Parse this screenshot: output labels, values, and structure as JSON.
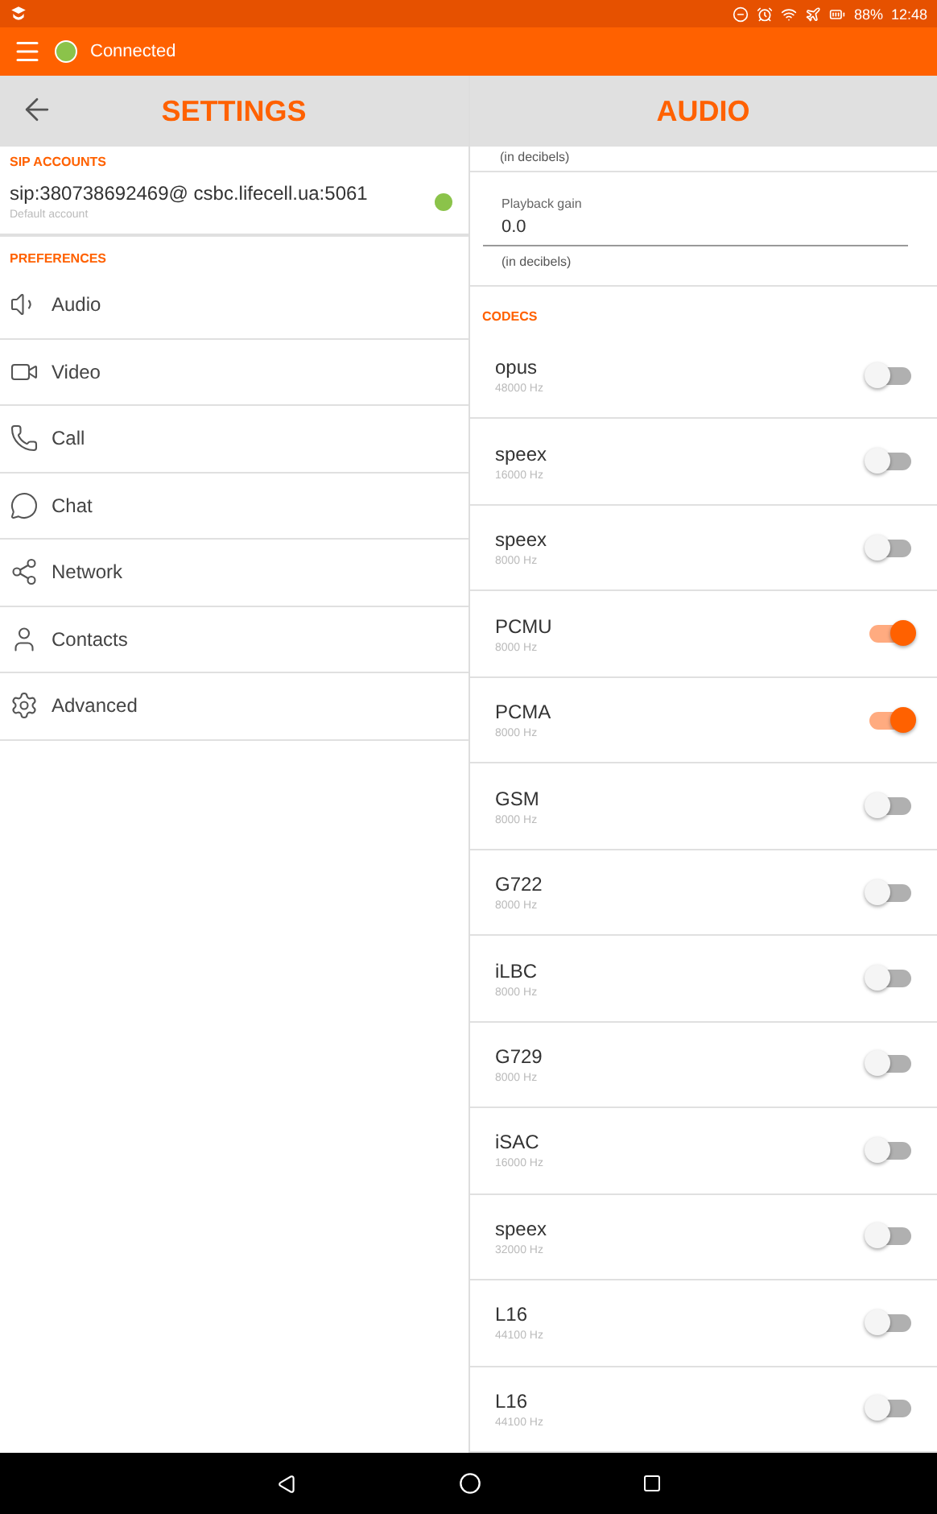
{
  "status_bar": {
    "battery": "88%",
    "time": "12:48"
  },
  "toolbar": {
    "status": "Connected",
    "connected": true
  },
  "left": {
    "title": "SETTINGS",
    "sip_header": "SIP ACCOUNTS",
    "account": {
      "address": "sip:380738692469@ csbc.lifecell.ua:5061",
      "subtitle": "Default account",
      "online": true
    },
    "pref_header": "PREFERENCES",
    "items": [
      {
        "label": "Audio",
        "kind": "audio"
      },
      {
        "label": "Video",
        "kind": "video"
      },
      {
        "label": "Call",
        "kind": "call"
      },
      {
        "label": "Chat",
        "kind": "chat"
      },
      {
        "label": "Network",
        "kind": "network"
      },
      {
        "label": "Contacts",
        "kind": "contacts"
      },
      {
        "label": "Advanced",
        "kind": "advanced"
      }
    ]
  },
  "right": {
    "title": "AUDIO",
    "prev_hint": "(in decibels)",
    "playback": {
      "label": "Playback gain",
      "value": "0.0",
      "hint": "(in decibels)"
    },
    "codecs_header": "CODECS",
    "codecs": [
      {
        "name": "opus",
        "rate": "48000 Hz",
        "on": false
      },
      {
        "name": "speex",
        "rate": "16000 Hz",
        "on": false
      },
      {
        "name": "speex",
        "rate": "8000 Hz",
        "on": false
      },
      {
        "name": "PCMU",
        "rate": "8000 Hz",
        "on": true
      },
      {
        "name": "PCMA",
        "rate": "8000 Hz",
        "on": true
      },
      {
        "name": "GSM",
        "rate": "8000 Hz",
        "on": false
      },
      {
        "name": "G722",
        "rate": "8000 Hz",
        "on": false
      },
      {
        "name": "iLBC",
        "rate": "8000 Hz",
        "on": false
      },
      {
        "name": "G729",
        "rate": "8000 Hz",
        "on": false
      },
      {
        "name": "iSAC",
        "rate": "16000 Hz",
        "on": false
      },
      {
        "name": "speex",
        "rate": "32000 Hz",
        "on": false
      },
      {
        "name": "L16",
        "rate": "44100 Hz",
        "on": false
      },
      {
        "name": "L16",
        "rate": "44100 Hz",
        "on": false
      }
    ]
  }
}
